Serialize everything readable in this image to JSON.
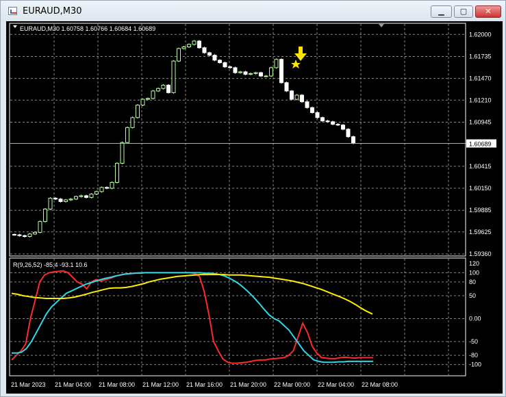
{
  "window": {
    "title": "EURAUD,M30",
    "min_label": "▁",
    "max_label": "▢",
    "close_label": "✕"
  },
  "chart_header": "EURAUD,M30  1.60758 1.60766 1.60684 1.60689",
  "indicator_header": "R(9,26,52) -85.4 -93.1 10.6",
  "price_axis": {
    "ticks": [
      "1.62000",
      "1.61735",
      "1.61470",
      "1.61210",
      "1.60945",
      "1.60415",
      "1.60150",
      "1.59885",
      "1.59625",
      "1.59360"
    ],
    "current_price": "1.60689"
  },
  "indicator_axis": {
    "ticks": [
      "120",
      "100",
      "80",
      "50",
      "0.00",
      "-50",
      "-80",
      "-100"
    ]
  },
  "time_axis": {
    "ticks": [
      "21 Mar 2023",
      "21 Mar 04:00",
      "21 Mar 08:00",
      "21 Mar 12:00",
      "21 Mar 16:00",
      "21 Mar 20:00",
      "22 Mar 00:00",
      "22 Mar 04:00",
      "22 Mar 08:00"
    ]
  },
  "colors": {
    "background": "#000000",
    "grid": "#8a8a8a",
    "bull_candle": "#b8ffa0",
    "bear_candle": "#ffffff",
    "marker": "#ffe600",
    "line_red": "#ff2a2a",
    "line_cyan": "#33d6e8",
    "line_yellow": "#ffee00"
  },
  "chart_data": [
    {
      "type": "candlestick",
      "series": [
        {
          "name": "EURAUD,M30",
          "close": [
            1.5959,
            1.5958,
            1.5957,
            1.596,
            1.5962,
            1.5975,
            1.599,
            1.6003,
            1.6002,
            1.5999,
            1.6001,
            1.6002,
            1.6005,
            1.6006,
            1.6004,
            1.6008,
            1.6011,
            1.6016,
            1.6015,
            1.6022,
            1.6045,
            1.607,
            1.6088,
            1.61,
            1.6115,
            1.6122,
            1.6123,
            1.6132,
            1.6135,
            1.6139,
            1.613,
            1.6168,
            1.6183,
            1.6185,
            1.6188,
            1.6192,
            1.6184,
            1.6178,
            1.6175,
            1.6169,
            1.6166,
            1.6161,
            1.616,
            1.6154,
            1.6155,
            1.6152,
            1.6153,
            1.6154,
            1.615,
            1.615,
            1.616,
            1.617,
            1.6142,
            1.6132,
            1.6122,
            1.6127,
            1.6119,
            1.6112,
            1.6106,
            1.61,
            1.6096,
            1.6095,
            1.6092,
            1.6091,
            1.6086,
            1.6077,
            1.6069
          ]
        }
      ],
      "ylim": [
        1.5936,
        1.6206
      ]
    },
    {
      "type": "line",
      "series": [
        {
          "name": "red",
          "values": [
            -90,
            -80,
            -70,
            -55,
            0,
            40,
            80,
            95,
            100,
            102,
            103,
            104,
            100,
            90,
            80,
            75,
            65,
            80,
            85,
            82,
            85,
            88,
            92,
            95,
            97,
            98,
            99,
            100,
            100,
            100,
            100,
            100,
            100,
            100,
            100,
            100,
            100,
            100,
            100,
            98,
            92,
            60,
            10,
            -50,
            -70,
            -88,
            -95,
            -97,
            -97,
            -96,
            -95,
            -93,
            -91,
            -90,
            -90,
            -88,
            -87,
            -86,
            -85,
            -80,
            -70,
            -40,
            -10,
            -30,
            -60,
            -75,
            -85,
            -86,
            -87,
            -87,
            -85,
            -84,
            -85,
            -86,
            -85,
            -85,
            -85,
            -85
          ]
        },
        {
          "name": "cyan",
          "values": [
            -75,
            -75,
            -73,
            -65,
            -50,
            -30,
            -10,
            10,
            25,
            35,
            45,
            55,
            60,
            65,
            70,
            75,
            78,
            82,
            85,
            88,
            90,
            93,
            95,
            97,
            98,
            99,
            99,
            100,
            100,
            100,
            100,
            100,
            100,
            100,
            100,
            100,
            100,
            100,
            100,
            99,
            99,
            98,
            96,
            93,
            88,
            82,
            75,
            66,
            56,
            45,
            33,
            20,
            8,
            0,
            -5,
            -15,
            -25,
            -40,
            -55,
            -70,
            -80,
            -90,
            -93,
            -95,
            -95,
            -95,
            -94,
            -94,
            -93,
            -93,
            -93,
            -93,
            -93,
            -93
          ]
        },
        {
          "name": "yellow",
          "values": [
            55,
            53,
            50,
            48,
            46,
            45,
            44,
            44,
            44,
            44,
            45,
            47,
            50,
            53,
            57,
            60,
            63,
            66,
            67,
            67,
            68,
            70,
            73,
            76,
            80,
            83,
            86,
            88,
            90,
            92,
            93,
            94,
            95,
            96,
            96,
            96,
            96,
            96,
            95,
            95,
            95,
            94,
            93,
            92,
            91,
            90,
            88,
            86,
            84,
            82,
            79,
            76,
            72,
            68,
            64,
            59,
            54,
            49,
            44,
            38,
            31,
            23,
            16,
            10
          ]
        }
      ],
      "ylim": [
        -120,
        120
      ]
    }
  ]
}
